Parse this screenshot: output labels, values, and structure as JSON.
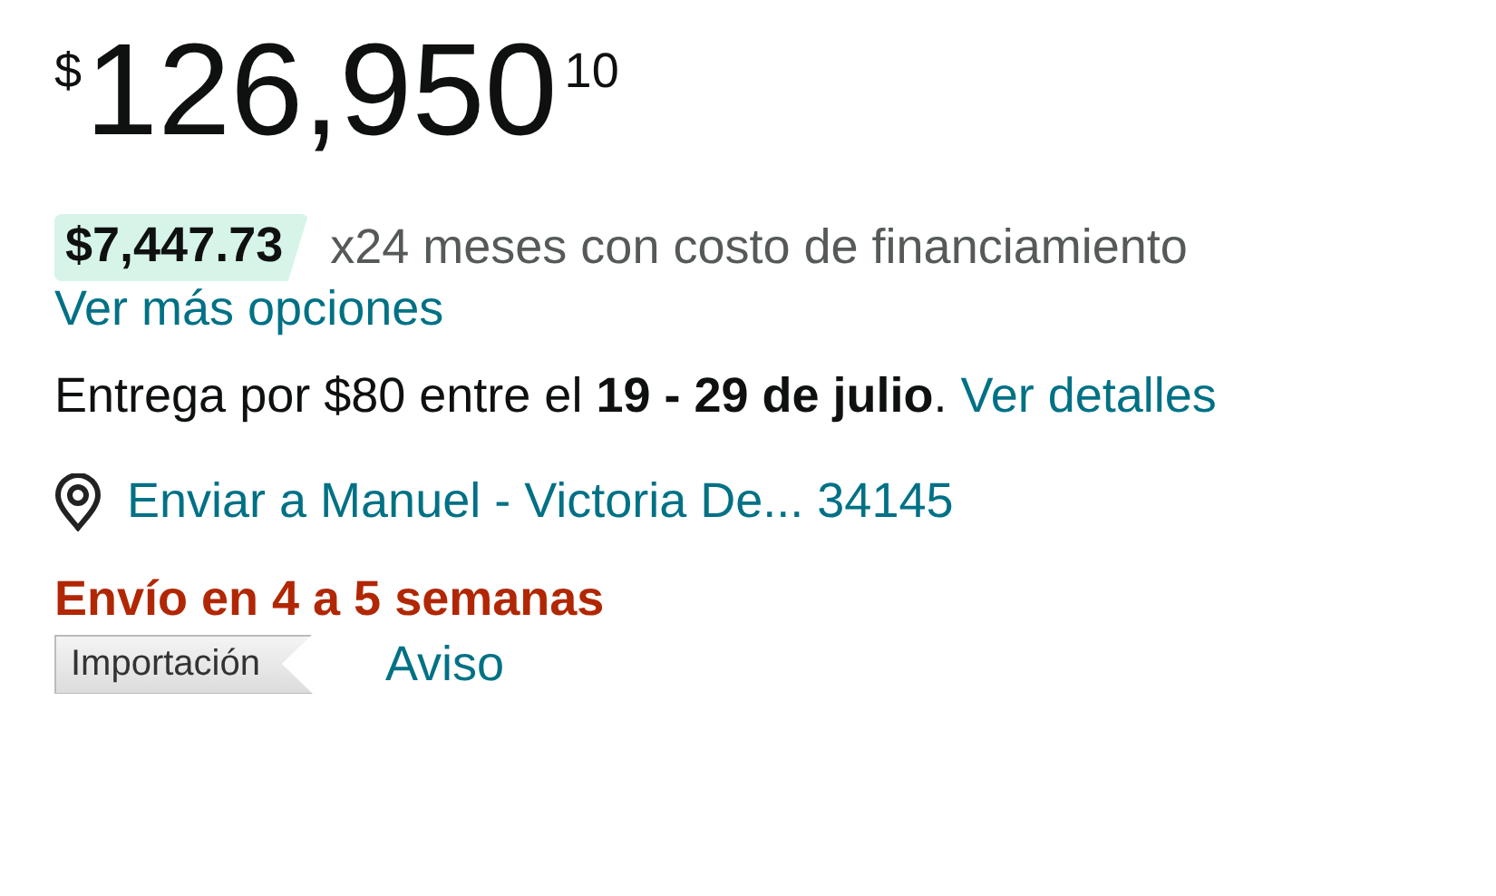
{
  "price": {
    "currency": "$",
    "whole": "126,950",
    "cents": "10"
  },
  "installment": {
    "amount": "$7,447.73",
    "terms": "x24 meses con costo de financiamiento"
  },
  "more_options_link": "Ver más opciones",
  "delivery": {
    "text": "Entrega por $80 entre el **19 - 29 de julio**.",
    "link": "Ver detalles"
  },
  "ship_to": {
    "link": "Enviar a Manuel - Victoria De... 34145"
  },
  "shipping_time": "Envío en 4 a 5 semanas",
  "badge": "Importación",
  "notice_link": "Aviso"
}
